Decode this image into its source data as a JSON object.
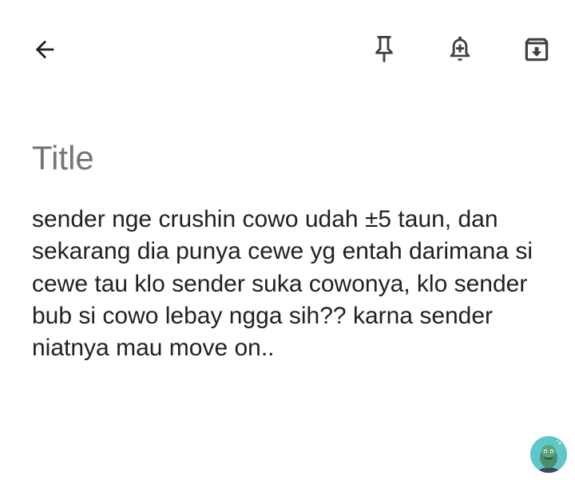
{
  "toolbar": {
    "back_icon": "arrow-left-icon",
    "pin_icon": "pin-icon",
    "reminder_icon": "bell-plus-icon",
    "archive_icon": "archive-icon",
    "icon_color": "#3c4043"
  },
  "note": {
    "title_placeholder": "Title",
    "title_value": "",
    "body_text": "sender nge crushin cowo udah ±5 taun, dan sekarang dia punya cewe yg entah darimana si cewe tau klo sender suka cowonya, klo sender bub si cowo lebay ngga sih?? karna sender niatnya mau move on.."
  },
  "avatar": {
    "icon": "cartoon-avatar-icon",
    "background_color": "#5fc7c9"
  },
  "colors": {
    "background": "#ffffff",
    "text": "#202124",
    "placeholder": "#9e9e9e"
  }
}
